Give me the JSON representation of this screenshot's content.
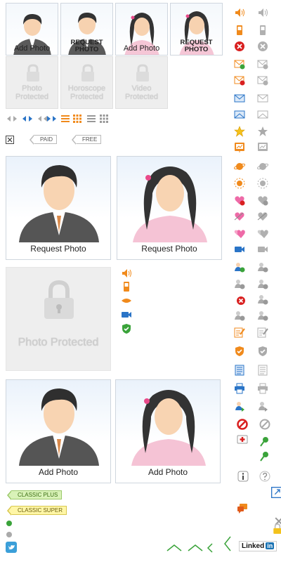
{
  "small_tiles": [
    {
      "label": "Add Photo"
    },
    {
      "label": "REQUEST PHOTO"
    },
    {
      "label": "Add Photo"
    },
    {
      "label": "REQUEST PHOTO"
    }
  ],
  "locked_tiles": [
    {
      "label": "Photo Protected"
    },
    {
      "label": "Horoscope Protected"
    },
    {
      "label": "Video Protected"
    }
  ],
  "tags": {
    "paid": "PAID",
    "free": "FREE",
    "classic_plus": "CLASSIC PLUS",
    "classic_super": "CLASSIC SUPER"
  },
  "big_tiles": {
    "request_male": "Request Photo",
    "request_female": "Request Photo",
    "protected": "Photo Protected",
    "add_male": "Add Photo",
    "add_female": "Add Photo"
  },
  "social": {
    "linkedin_text": "Linked",
    "linkedin_badge": "in"
  },
  "colors": {
    "accent_orange": "#f08a1c",
    "accent_blue": "#2a74c7",
    "green": "#3aa33a",
    "red": "#d92020",
    "gray_icon": "#b0b0b0"
  }
}
